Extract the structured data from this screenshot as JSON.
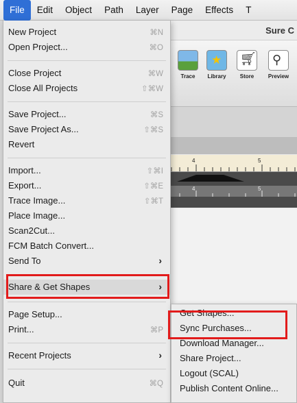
{
  "menubar": {
    "items": [
      "File",
      "Edit",
      "Object",
      "Path",
      "Layer",
      "Page",
      "Effects",
      "T"
    ],
    "active_index": 0
  },
  "window": {
    "title": "Sure C",
    "toolbar": [
      {
        "label": "Trace",
        "icon": "trace-image-icon"
      },
      {
        "label": "Library",
        "icon": "library-star-icon"
      },
      {
        "label": "Store",
        "icon": "cart-icon"
      },
      {
        "label": "Preview",
        "icon": "preview-magnifier-icon"
      }
    ],
    "ruler_numbers": [
      "4",
      "5"
    ]
  },
  "file_menu": {
    "items": [
      {
        "label": "New Project",
        "shortcut": "⌘N"
      },
      {
        "label": "Open Project...",
        "shortcut": "⌘O"
      },
      {
        "label": "Close Project",
        "shortcut": "⌘W"
      },
      {
        "label": "Close All Projects",
        "shortcut": "⇧⌘W"
      },
      {
        "label": "Save Project...",
        "shortcut": "⌘S"
      },
      {
        "label": "Save Project As...",
        "shortcut": "⇧⌘S"
      },
      {
        "label": "Revert",
        "shortcut": ""
      },
      {
        "label": "Import...",
        "shortcut": "⇧⌘I"
      },
      {
        "label": "Export...",
        "shortcut": "⇧⌘E"
      },
      {
        "label": "Trace Image...",
        "shortcut": "⇧⌘T"
      },
      {
        "label": "Place Image...",
        "shortcut": ""
      },
      {
        "label": "Scan2Cut...",
        "shortcut": ""
      },
      {
        "label": "FCM Batch Convert...",
        "shortcut": ""
      },
      {
        "label": "Send To",
        "shortcut": ""
      },
      {
        "label": "Share & Get Shapes",
        "shortcut": ""
      },
      {
        "label": "Page Setup...",
        "shortcut": ""
      },
      {
        "label": "Print...",
        "shortcut": "⌘P"
      },
      {
        "label": "Recent Projects",
        "shortcut": ""
      },
      {
        "label": "Quit",
        "shortcut": "⌘Q"
      }
    ]
  },
  "share_submenu": {
    "items": [
      {
        "label": "Get Shapes..."
      },
      {
        "label": "Sync Purchases..."
      },
      {
        "label": "Download Manager..."
      },
      {
        "label": "Share Project..."
      },
      {
        "label": "Logout (SCAL)"
      },
      {
        "label": "Publish Content Online..."
      }
    ]
  },
  "colors": {
    "highlight_box": "#e21b1b",
    "menubar_active": "#2f6fd6"
  }
}
